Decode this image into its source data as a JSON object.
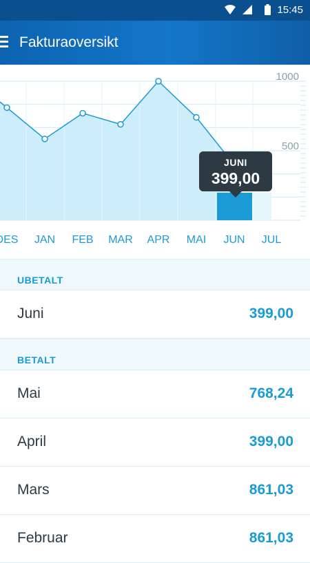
{
  "statusbar": {
    "time": "15:45"
  },
  "appbar": {
    "title": "Fakturaoversikt"
  },
  "chart_data": {
    "type": "area",
    "categories": [
      "DES",
      "JAN",
      "FEB",
      "MAR",
      "APR",
      "MAI",
      "JUN",
      "JUL"
    ],
    "values": [
      810,
      585,
      770,
      690,
      1000,
      740,
      399,
      null
    ],
    "ytick_labels": [
      "1000",
      "500"
    ],
    "ylim": [
      0,
      1000
    ],
    "selected": {
      "month_label": "JUNI",
      "value_label": "399,00"
    }
  },
  "sections": [
    {
      "title": "UBETALT",
      "rows": [
        {
          "label": "Juni",
          "amount": "399,00"
        }
      ]
    },
    {
      "title": "BETALT",
      "rows": [
        {
          "label": "Mai",
          "amount": "768,24"
        },
        {
          "label": "April",
          "amount": "399,00"
        },
        {
          "label": "Mars",
          "amount": "861,03"
        },
        {
          "label": "Februar",
          "amount": "861,03"
        }
      ]
    }
  ]
}
